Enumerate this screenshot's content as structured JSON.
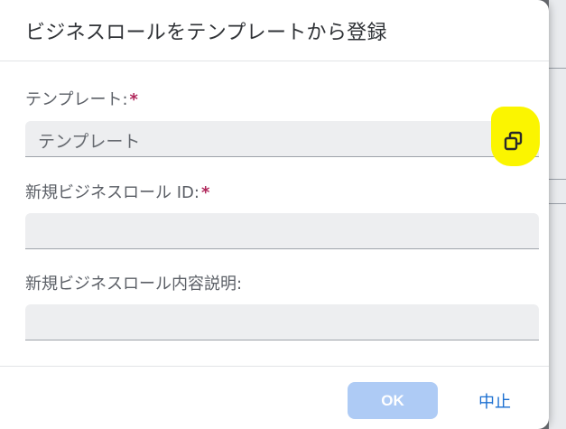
{
  "dialog": {
    "title": "ビジネスロールをテンプレートから登録"
  },
  "fields": {
    "template": {
      "label": "テンプレート:",
      "required_mark": "*",
      "value": "テンプレート",
      "select_icon": "open-in-new-window-icon",
      "highlight_color": "#fbf500"
    },
    "role_id": {
      "label": "新規ビジネスロール ID:",
      "required_mark": "*",
      "value": ""
    },
    "description": {
      "label": "新規ビジネスロール内容説明:",
      "value": ""
    }
  },
  "footer": {
    "ok_label": "OK",
    "cancel_label": "中止"
  },
  "colors": {
    "accent": "#1b6fd1",
    "required": "#b0265a",
    "ok_disabled": "#aecbf5"
  }
}
